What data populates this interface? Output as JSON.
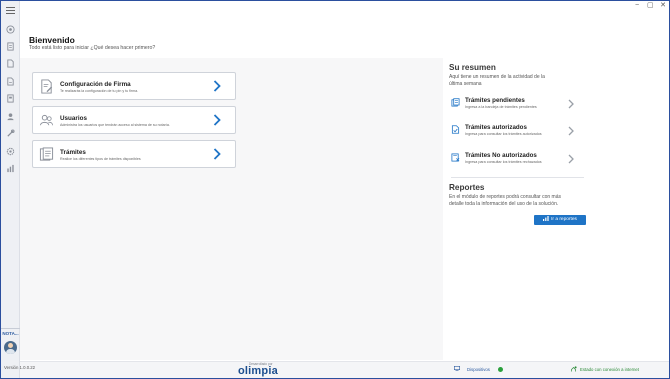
{
  "window": {
    "controls": [
      "−",
      "▢",
      "✕"
    ]
  },
  "sidebar": {
    "icons": [
      "home-icon",
      "users-icon",
      "document-icon",
      "files-icon",
      "book-icon",
      "person-icon",
      "tools-icon",
      "settings-icon",
      "chart-icon"
    ],
    "nota_label": "NOTA..."
  },
  "header": {
    "title": "Bienvenido",
    "subtitle": "Todo está listo para iniciar ¿Qué desea hacer primero?"
  },
  "cards": [
    {
      "title": "Configuración de Firma",
      "desc": "Te realizarás la configuración de tu pin y tu firma.",
      "icon": "signature-doc-icon"
    },
    {
      "title": "Usuarios",
      "desc": "Administra los usuarios que tendrán acceso al sistema de su notaría.",
      "icon": "users-icon"
    },
    {
      "title": "Trámites",
      "desc": "Realice los diferentes tipos de trámites disponibles",
      "icon": "procedures-icon"
    }
  ],
  "summary": {
    "title": "Su resumen",
    "desc": "Aquí tiene un resumen de la actividad de la última semana",
    "items": [
      {
        "title": "Trámites pendientes",
        "desc": "Ingresa a la bandeja de trámites pendientes",
        "icon": "pending-docs-icon"
      },
      {
        "title": "Trámites autorizados",
        "desc": "Ingresa para consultar los trámites autorizados",
        "icon": "authorized-doc-icon"
      },
      {
        "title": "Trámites No autorizados",
        "desc": "Ingresa para consultar los trámites rechazados",
        "icon": "rejected-doc-icon"
      }
    ]
  },
  "reports": {
    "title": "Reportes",
    "desc": "En el módulo de reportes podrá consultar con más detalle toda la información del uso de la solución.",
    "button_label": "Ir a reportes"
  },
  "status": {
    "version": "Versión 1.0.0.22",
    "brand_caption": "Desarrollado por",
    "brand_name": "olimpia",
    "devices_label": "Dispositivos",
    "connection_label": "Estado con conexión a internet",
    "connection_color": "#2aa03c",
    "accent_color": "#1f74c6"
  }
}
